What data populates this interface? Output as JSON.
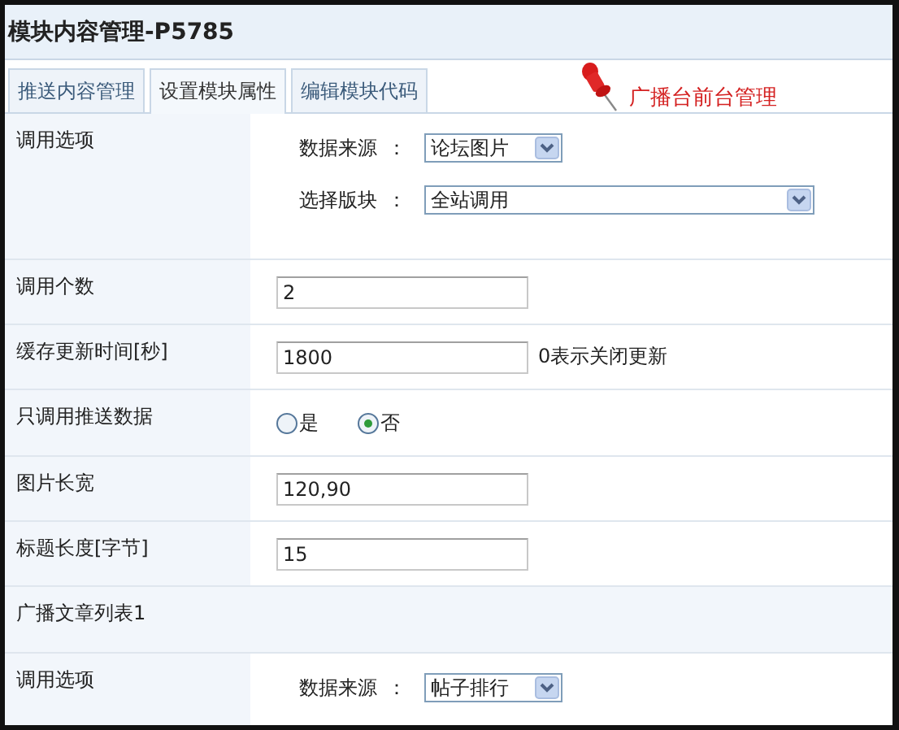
{
  "window": {
    "title": "模块内容管理-P5785"
  },
  "tabs": [
    {
      "label": "推送内容管理",
      "selected": false
    },
    {
      "label": "设置模块属性",
      "selected": true
    },
    {
      "label": "编辑模块代码",
      "selected": false
    }
  ],
  "annotation": {
    "text": "广播台前台管理"
  },
  "rows": [
    {
      "kind": "options",
      "label": "调用选项",
      "selects": [
        {
          "label": "数据来源",
          "colon": "：",
          "value": "论坛图片",
          "kind": "short"
        },
        {
          "label": "选择版块",
          "colon": "：",
          "value": "全站调用",
          "kind": "long"
        }
      ]
    },
    {
      "kind": "input",
      "label": "调用个数",
      "value": "2"
    },
    {
      "kind": "input",
      "label": "缓存更新时间[秒]",
      "value": "1800",
      "note": "0表示关闭更新"
    },
    {
      "kind": "radio",
      "label": "只调用推送数据",
      "options": [
        {
          "label": "是",
          "selected": false
        },
        {
          "label": "否",
          "selected": true
        }
      ]
    },
    {
      "kind": "input",
      "label": "图片长宽",
      "value": "120,90"
    },
    {
      "kind": "input",
      "label": "标题长度[字节]",
      "value": "15"
    },
    {
      "kind": "section",
      "label": "广播文章列表1"
    },
    {
      "kind": "options",
      "label": "调用选项",
      "selects": [
        {
          "label": "数据来源",
          "colon": "：",
          "value": "帖子排行",
          "kind": "short"
        }
      ]
    }
  ]
}
